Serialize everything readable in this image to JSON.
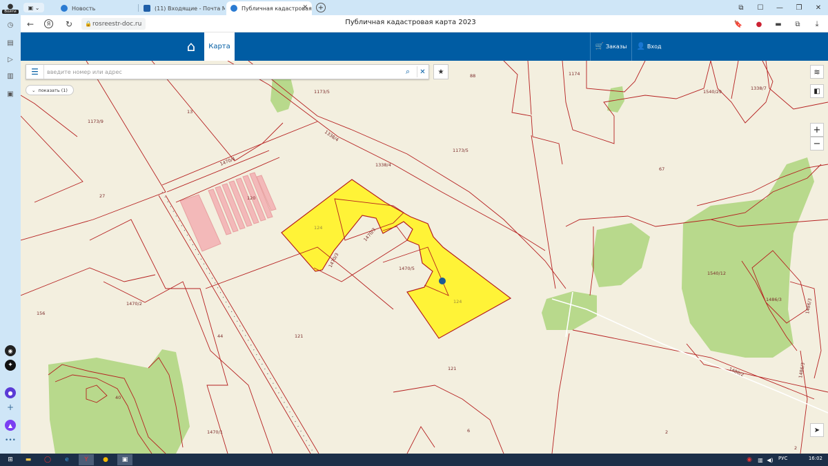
{
  "browser": {
    "profile_label": "Войти",
    "tabs": [
      {
        "label": "Новость",
        "active": false
      },
      {
        "label": "(11) Входящие - Почта М",
        "active": false
      },
      {
        "label": "Публичная кадастровая",
        "active": true
      }
    ],
    "url": "rosreestr-doc.ru",
    "page_title": "Публичная кадастровая карта 2023"
  },
  "site": {
    "nav": {
      "map_tab": "Карта",
      "orders": "Заказы",
      "login": "Вход"
    },
    "search": {
      "placeholder": "введите номер или адрес",
      "value": ""
    },
    "show_toggle": "показать (1)",
    "zoom": {
      "in": "+",
      "out": "−"
    },
    "colors": {
      "header": "#005ca3",
      "parcel_selected": "#fff337",
      "parcel_border": "#b51f1f",
      "forest": "#b5d88a",
      "map_bg": "#f3efdf"
    }
  },
  "map": {
    "parcel_labels": [
      "88",
      "1174",
      "1540/29",
      "1338/7",
      "13",
      "1173/5",
      "1173/9",
      "1338/4",
      "1173/5",
      "1470/4",
      "1338/4",
      "67",
      "27",
      "120",
      "124",
      "1470/3",
      "1470/3",
      "1470/5",
      "1540/12",
      "1470/2",
      "124",
      "1486/3",
      "156",
      "44",
      "121",
      "1486/3",
      "121",
      "1486/2",
      "40",
      "1470/1",
      "6",
      "2",
      "2"
    ]
  },
  "taskbar": {
    "language": "РУС",
    "time": "16:02"
  }
}
